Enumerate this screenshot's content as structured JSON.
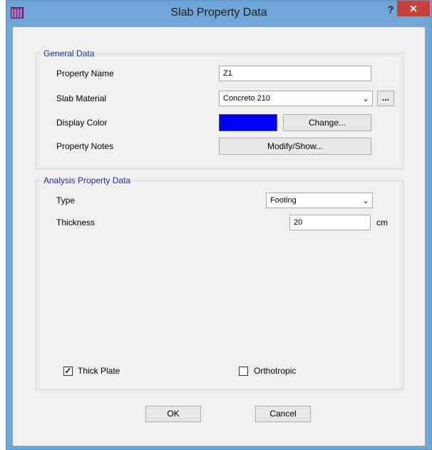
{
  "window": {
    "title": "Slab Property Data",
    "help_label": "?",
    "close_label": "✕"
  },
  "general": {
    "group_title": "General Data",
    "property_name_label": "Property Name",
    "property_name_value": "Z1",
    "slab_material_label": "Slab Material",
    "slab_material_value": "Concreto 210",
    "ellipsis_label": "...",
    "display_color_label": "Display Color",
    "display_color": "#0000ff",
    "change_label": "Change...",
    "property_notes_label": "Property Notes",
    "modify_show_label": "Modify/Show..."
  },
  "analysis": {
    "group_title": "Analysis Property Data",
    "type_label": "Type",
    "type_value": "Footing",
    "thickness_label": "Thickness",
    "thickness_value": "20",
    "thickness_unit": "cm",
    "thick_plate_label": "Thick Plate",
    "thick_plate_checked": true,
    "orthotropic_label": "Orthotropic",
    "orthotropic_checked": false
  },
  "buttons": {
    "ok_label": "OK",
    "cancel_label": "Cancel"
  }
}
